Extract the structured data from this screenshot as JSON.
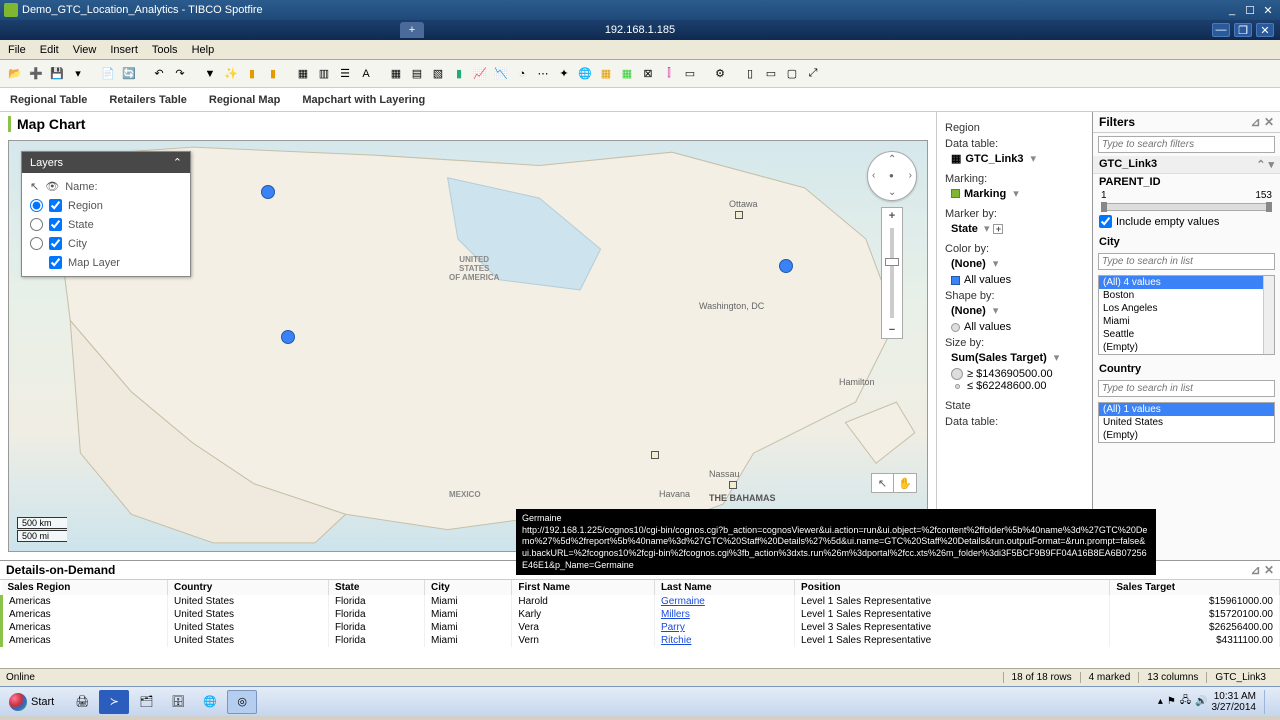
{
  "window": {
    "title": "Demo_GTC_Location_Analytics - TIBCO Spotfire",
    "ip": "192.168.1.185"
  },
  "menus": [
    "File",
    "Edit",
    "View",
    "Insert",
    "Tools",
    "Help"
  ],
  "pagetabs": [
    "Regional Table",
    "Retailers Table",
    "Regional Map",
    "Mapchart with Layering"
  ],
  "map": {
    "title": "Map Chart",
    "layers_header": "Layers",
    "layers": [
      "Name:",
      "Region",
      "State",
      "City",
      "Map Layer"
    ],
    "scale_km": "500 km",
    "scale_mi": "500 mi",
    "labels": {
      "usa1": "UNITED",
      "usa2": "STATES",
      "usa3": "OF AMERICA",
      "mexico": "MEXICO",
      "bahamas": "THE BAHAMAS",
      "ottawa": "Ottawa",
      "washington": "Washington, DC",
      "hamilton": "Hamilton",
      "nassau": "Nassau",
      "havana": "Havana"
    }
  },
  "legend": {
    "region": "Region",
    "data_table_h": "Data table:",
    "data_table": "GTC_Link3",
    "marking_h": "Marking:",
    "marking": "Marking",
    "marker_by_h": "Marker by:",
    "marker_by": "State",
    "color_by_h": "Color by:",
    "color_by": "(None)",
    "all_values": "All values",
    "shape_by_h": "Shape by:",
    "shape_by": "(None)",
    "size_by_h": "Size by:",
    "size_by": "Sum(Sales Target)",
    "size_ge": "≥ $143690500.00",
    "size_le": "≤ $62248600.00",
    "state_h": "State",
    "data_table2_h": "Data table:"
  },
  "filters": {
    "title": "Filters",
    "search_ph": "Type to search filters",
    "gtc": "GTC_Link3",
    "parent_id": "PARENT_ID",
    "range_min": "1",
    "range_max": "153",
    "include_empty": "Include empty values",
    "city_h": "City",
    "list_search_ph": "Type to search in list",
    "city_items": [
      "(All) 4 values",
      "Boston",
      "Los Angeles",
      "Miami",
      "Seattle",
      "(Empty)"
    ],
    "country_h": "Country",
    "country_items": [
      "(All) 1 values",
      "United States",
      "(Empty)"
    ]
  },
  "tooltip": {
    "name": "Germaine",
    "url": "http://192.168.1.225/cognos10/cgi-bin/cognos.cgi?b_action=cognosViewer&ui.action=run&ui.object=%2fcontent%2ffolder%5b%40name%3d%27GTC%20Demo%27%5d%2freport%5b%40name%3d%27GTC%20Staff%20Details%27%5d&ui.name=GTC%20Staff%20Details&run.outputFormat=&run.prompt=false&ui.backURL=%2fcognos10%2fcgi-bin%2fcognos.cgi%3fb_action%3dxts.run%26m%3dportal%2fcc.xts%26m_folder%3di3F5BCF9B9FF04A16B8EA6B07256E46E1&p_Name=Germaine"
  },
  "details": {
    "title": "Details-on-Demand",
    "columns": [
      "Sales Region",
      "Country",
      "State",
      "City",
      "First Name",
      "Last Name",
      "Position",
      "Sales Target"
    ],
    "rows": [
      [
        "Americas",
        "United States",
        "Florida",
        "Miami",
        "Harold",
        "Germaine",
        "Level 1 Sales Representative",
        "$15961000.00"
      ],
      [
        "Americas",
        "United States",
        "Florida",
        "Miami",
        "Karly",
        "Millers",
        "Level 1 Sales Representative",
        "$15720100.00"
      ],
      [
        "Americas",
        "United States",
        "Florida",
        "Miami",
        "Vera",
        "Parry",
        "Level 3 Sales Representative",
        "$26256400.00"
      ],
      [
        "Americas",
        "United States",
        "Florida",
        "Miami",
        "Vern",
        "Ritchie",
        "Level 1 Sales Representative",
        "$4311100.00"
      ]
    ]
  },
  "status": {
    "online": "Online",
    "rows": "18 of 18 rows",
    "marked": "4 marked",
    "cols": "13 columns",
    "ds": "GTC_Link3"
  },
  "taskbar": {
    "start": "Start",
    "time": "10:31 AM",
    "date": "3/27/2014"
  }
}
